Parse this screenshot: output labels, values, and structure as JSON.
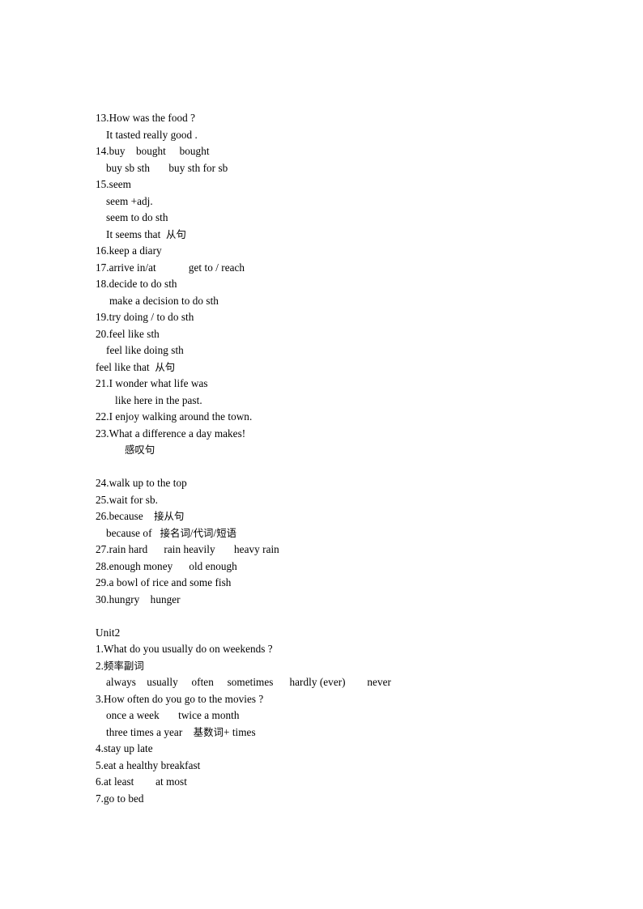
{
  "document": {
    "page_background": "#ffffff",
    "text_color": "#000000",
    "lines": [
      {
        "id": "l13",
        "indent": 0,
        "text": "13.How was the food ?"
      },
      {
        "id": "l13b",
        "indent": 1,
        "text": "It tasted really good ."
      },
      {
        "id": "l14",
        "indent": 0,
        "text": "14.buy    bought     bought"
      },
      {
        "id": "l14b",
        "indent": 1,
        "text": "buy sb sth       buy sth for sb"
      },
      {
        "id": "l15",
        "indent": 0,
        "text": "15.seem"
      },
      {
        "id": "l15b",
        "indent": 1,
        "text": "seem +adj."
      },
      {
        "id": "l15c",
        "indent": 1,
        "text": "seem to do sth"
      },
      {
        "id": "l15d",
        "indent": 1,
        "text": "It seems that  从句"
      },
      {
        "id": "l16",
        "indent": 0,
        "text": "16.keep a diary"
      },
      {
        "id": "l17",
        "indent": 0,
        "text": "17.arrive in/at            get to / reach"
      },
      {
        "id": "l18",
        "indent": 0,
        "text": "18.decide to do sth"
      },
      {
        "id": "l18b",
        "indent": 2,
        "text": "make a decision to do sth"
      },
      {
        "id": "l19",
        "indent": 0,
        "text": "19.try doing / to do sth"
      },
      {
        "id": "l20",
        "indent": 0,
        "text": "20.feel like sth"
      },
      {
        "id": "l20b",
        "indent": 1,
        "text": "feel like doing sth"
      },
      {
        "id": "l20c",
        "indent": 0,
        "text": "feel like that  从句"
      },
      {
        "id": "l21",
        "indent": 0,
        "text": "21.I wonder what life was"
      },
      {
        "id": "l21b",
        "indent": 3,
        "text": "like here in the past."
      },
      {
        "id": "l22",
        "indent": 0,
        "text": "22.I enjoy walking around the town."
      },
      {
        "id": "l23",
        "indent": 0,
        "text": "23.What a difference a day makes!"
      },
      {
        "id": "l23b",
        "indent": 4,
        "text": "感叹句"
      },
      {
        "id": "gap1",
        "indent": 0,
        "text": ""
      },
      {
        "id": "l24",
        "indent": 0,
        "text": "24.walk up to the top"
      },
      {
        "id": "l25",
        "indent": 0,
        "text": "25.wait for sb."
      },
      {
        "id": "l26",
        "indent": 0,
        "text": "26.because    接从句"
      },
      {
        "id": "l26b",
        "indent": 1,
        "text": "because of   接名词/代词/短语"
      },
      {
        "id": "l27",
        "indent": 0,
        "text": "27.rain hard      rain heavily       heavy rain"
      },
      {
        "id": "l28",
        "indent": 0,
        "text": "28.enough money      old enough"
      },
      {
        "id": "l29",
        "indent": 0,
        "text": "29.a bowl of rice and some fish"
      },
      {
        "id": "l30",
        "indent": 0,
        "text": "30.hungry    hunger"
      },
      {
        "id": "gap2",
        "indent": 0,
        "text": ""
      },
      {
        "id": "unit2",
        "indent": 0,
        "text": "Unit2"
      },
      {
        "id": "u2l1",
        "indent": 0,
        "text": "1.What do you usually do on weekends ?"
      },
      {
        "id": "u2l2",
        "indent": 0,
        "text": "2.频率副词"
      },
      {
        "id": "u2l2b",
        "indent": 1,
        "text": "always    usually     often     sometimes      hardly (ever)        never"
      },
      {
        "id": "u2l3",
        "indent": 0,
        "text": "3.How often do you go to the movies ?"
      },
      {
        "id": "u2l3b",
        "indent": 1,
        "text": "once a week       twice a month"
      },
      {
        "id": "u2l3c",
        "indent": 1,
        "text": "three times a year    基数词+ times"
      },
      {
        "id": "u2l4",
        "indent": 0,
        "text": "4.stay up late"
      },
      {
        "id": "u2l5",
        "indent": 0,
        "text": "5.eat a healthy breakfast"
      },
      {
        "id": "u2l6",
        "indent": 0,
        "text": "6.at least        at most"
      },
      {
        "id": "u2l7",
        "indent": 0,
        "text": "7.go to bed"
      }
    ]
  }
}
